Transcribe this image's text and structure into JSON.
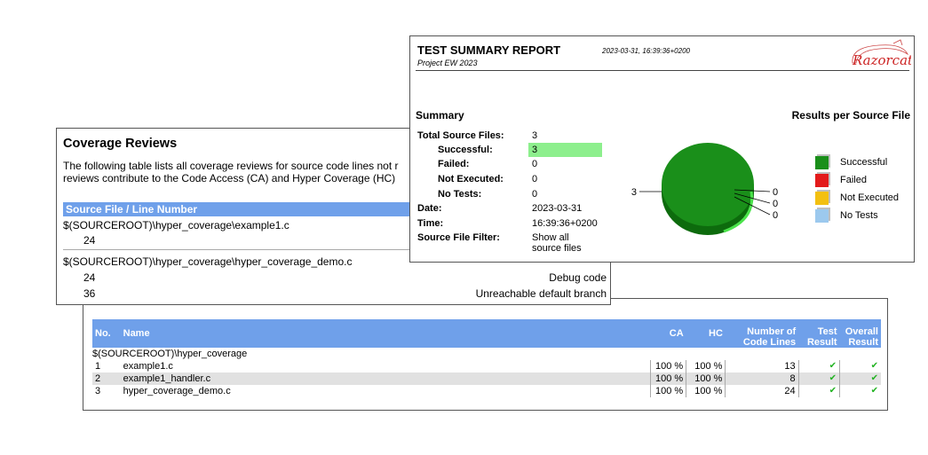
{
  "files_panel": {
    "headers": {
      "no": "No.",
      "name": "Name",
      "ca": "CA",
      "hc": "HC",
      "lines_1": "Number of",
      "lines_2": "Code Lines",
      "test_1": "Test",
      "test_2": "Result",
      "overall_1": "Overall",
      "overall_2": "Result"
    },
    "group": "$(SOURCEROOT)\\hyper_coverage",
    "rows": [
      {
        "no": "1",
        "name": "example1.c",
        "ca": "100 %",
        "hc": "100 %",
        "lines": "13",
        "test": "✔",
        "overall": "✔"
      },
      {
        "no": "2",
        "name": "example1_handler.c",
        "ca": "100 %",
        "hc": "100 %",
        "lines": "8",
        "test": "✔",
        "overall": "✔"
      },
      {
        "no": "3",
        "name": "hyper_coverage_demo.c",
        "ca": "100 %",
        "hc": "100 %",
        "lines": "24",
        "test": "✔",
        "overall": "✔"
      }
    ]
  },
  "coverage_panel": {
    "title": "Coverage Reviews",
    "intro_1": "The following table lists all coverage reviews for source code lines not r",
    "intro_2": "reviews contribute to the Code Access (CA) and Hyper Coverage (HC)",
    "header": "Source File / Line Number",
    "files": [
      {
        "path": "$(SOURCEROOT)\\hyper_coverage\\example1.c",
        "lines": [
          {
            "line": "24",
            "reason": ""
          }
        ]
      },
      {
        "path": "$(SOURCEROOT)\\hyper_coverage\\hyper_coverage_demo.c",
        "lines": [
          {
            "line": "24",
            "reason": "Debug code"
          },
          {
            "line": "36",
            "reason": "Unreachable default branch"
          }
        ]
      }
    ]
  },
  "summary_panel": {
    "title": "TEST SUMMARY REPORT",
    "date_stamp": "2023-03-31, 16:39:36+0200",
    "project": "Project EW 2023",
    "logo_text": "Razorcat",
    "summary_heading": "Summary",
    "results_heading": "Results per Source File",
    "rows": {
      "total_label": "Total Source Files:",
      "total_value": "3",
      "successful_label": "Successful:",
      "successful_value": "3",
      "failed_label": "Failed:",
      "failed_value": "0",
      "not_executed_label": "Not Executed:",
      "not_executed_value": "0",
      "no_tests_label": "No Tests:",
      "no_tests_value": "0",
      "date_label": "Date:",
      "date_value": "2023-03-31",
      "time_label": "Time:",
      "time_value": "16:39:36+0200",
      "filter_label": "Source File Filter:",
      "filter_value_1": "Show all",
      "filter_value_2": "source files"
    },
    "colors": {
      "successful": "#1a8f1a",
      "failed": "#e31b1b",
      "not_executed": "#f3c011",
      "no_tests": "#9cc9ee"
    }
  },
  "chart_data": {
    "type": "pie",
    "categories": [
      "Successful",
      "Failed",
      "Not Executed",
      "No Tests"
    ],
    "values": [
      3,
      0,
      0,
      0
    ],
    "title": "Results per Source File",
    "legend": "right"
  }
}
